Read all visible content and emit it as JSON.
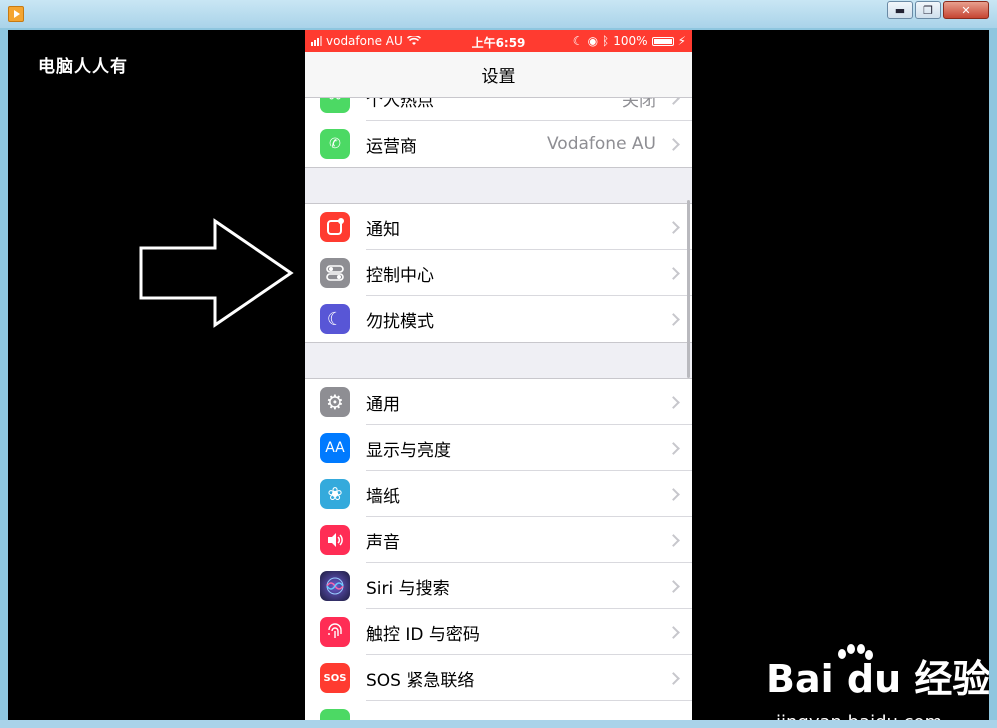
{
  "window": {
    "minimize": "▬",
    "restore": "❐",
    "close": "✕"
  },
  "watermark_left": "电脑人人有",
  "phone": {
    "status": {
      "carrier": "vodafone AU",
      "time": "上午6:59",
      "battery": "100%"
    },
    "nav_title": "设置",
    "rows": [
      {
        "label": "个人热点",
        "value": "关闭",
        "icon": "hotspot-icon",
        "color": "#4cd964"
      },
      {
        "label": "运营商",
        "value": "Vodafone AU",
        "icon": "phone-icon",
        "color": "#4cd964"
      },
      {
        "label": "通知",
        "value": "",
        "icon": "notifications-icon",
        "color": "#ff3b30"
      },
      {
        "label": "控制中心",
        "value": "",
        "icon": "control-center-icon",
        "color": "#8e8e93"
      },
      {
        "label": "勿扰模式",
        "value": "",
        "icon": "moon-icon",
        "color": "#5856d6"
      },
      {
        "label": "通用",
        "value": "",
        "icon": "gear-icon",
        "color": "#8e8e93"
      },
      {
        "label": "显示与亮度",
        "value": "",
        "icon": "display-icon",
        "color": "#007aff",
        "glyph": "AA"
      },
      {
        "label": "墙纸",
        "value": "",
        "icon": "wallpaper-icon",
        "color": "#34aadc"
      },
      {
        "label": "声音",
        "value": "",
        "icon": "speaker-icon",
        "color": "#ff2d55"
      },
      {
        "label": "Siri 与搜索",
        "value": "",
        "icon": "siri-icon",
        "color": "#1c1c3c"
      },
      {
        "label": "触控 ID 与密码",
        "value": "",
        "icon": "fingerprint-icon",
        "color": "#ff2d55"
      },
      {
        "label": "SOS 紧急联络",
        "value": "",
        "icon": "sos-icon",
        "color": "#ff3b30",
        "glyph": "SOS"
      },
      {
        "label": "",
        "value": "",
        "icon": "battery-icon",
        "color": "#4cd964"
      }
    ]
  },
  "baidu": {
    "main": "Bai du 经验",
    "sub": "jingyan.baidu.com"
  }
}
